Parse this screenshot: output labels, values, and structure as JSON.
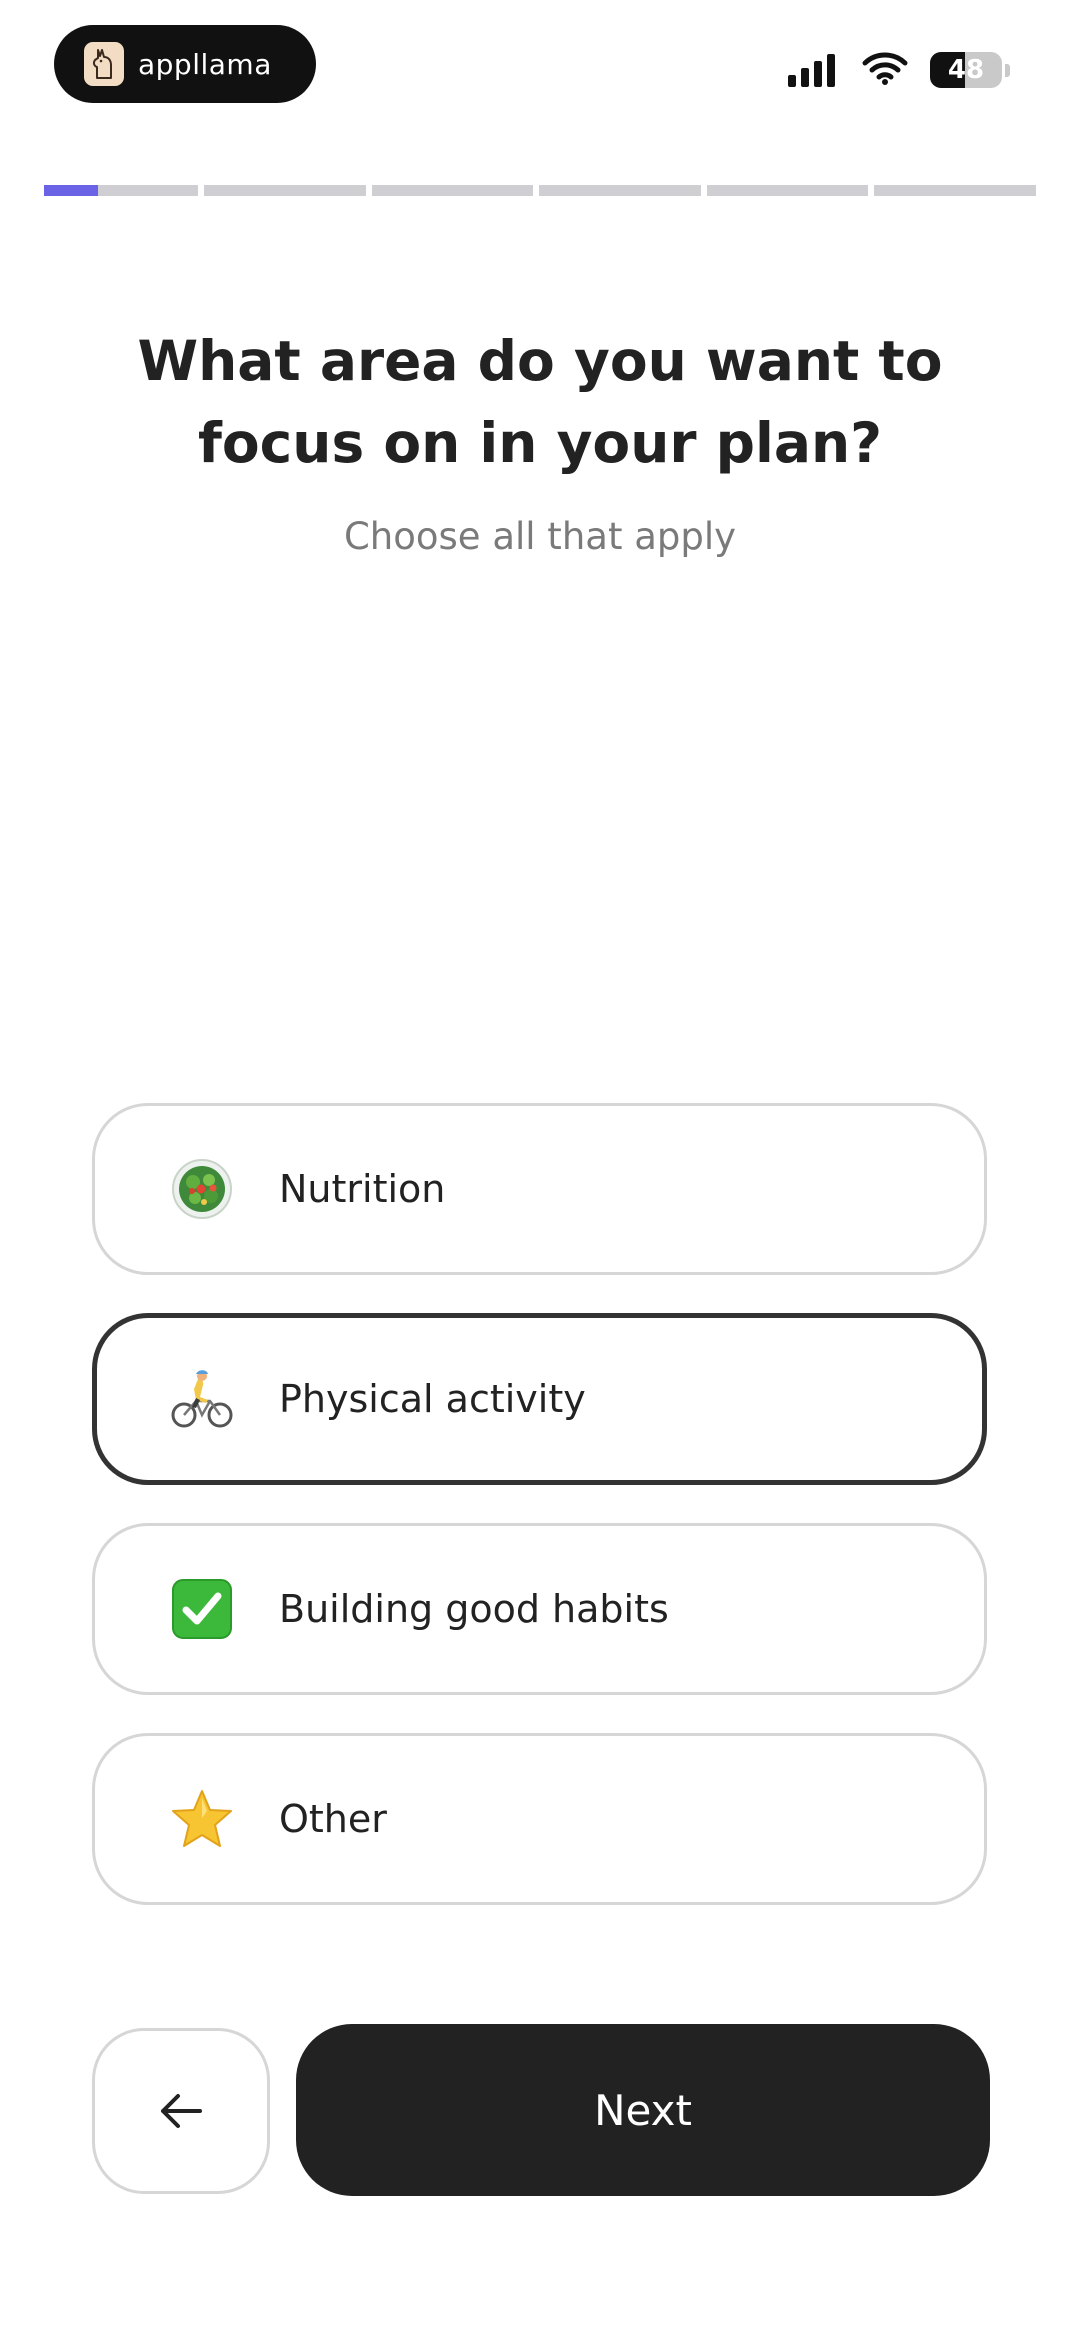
{
  "status_bar": {
    "app_badge": "appllama",
    "battery": "48",
    "battery_level": 0.48
  },
  "progress": {
    "segments": 6,
    "current_step": 1,
    "current_fill": 0.35,
    "accent_color": "#6b63e6"
  },
  "question": {
    "title_line1": "What area do you want to",
    "title_line2": "focus on in your plan?",
    "subtitle": "Choose all that apply"
  },
  "options": [
    {
      "label": "Nutrition",
      "icon": "salad-icon",
      "selected": false
    },
    {
      "label": "Physical activity",
      "icon": "cyclist-icon",
      "selected": true
    },
    {
      "label": "Building good habits",
      "icon": "check-mark-icon",
      "selected": false
    },
    {
      "label": "Other",
      "icon": "star-icon",
      "selected": false
    }
  ],
  "footer": {
    "back_icon": "arrow-left-icon",
    "next_label": "Next"
  }
}
